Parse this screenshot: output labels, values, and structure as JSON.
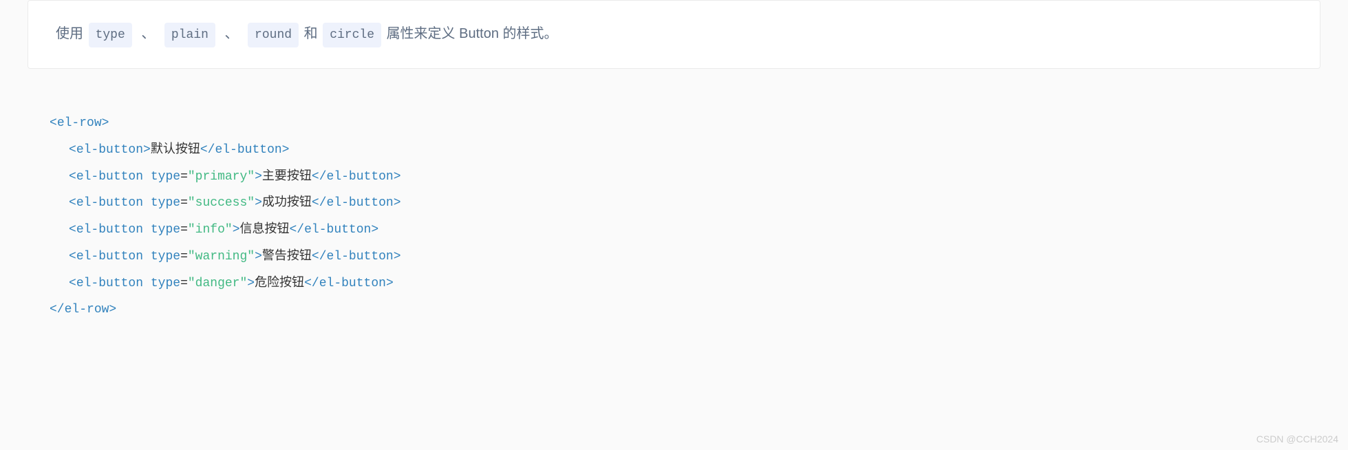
{
  "description": {
    "prefix": "使用",
    "code1": "type",
    "sep": "、",
    "code2": "plain",
    "code3": "round",
    "and": "和",
    "code4": "circle",
    "suffix": "属性来定义 Button 的样式。"
  },
  "code": {
    "rowOpen": {
      "lt": "<",
      "name": "el-row",
      "gt": ">"
    },
    "rowClose": {
      "lt": "</",
      "name": "el-row",
      "gt": ">"
    },
    "btnTag": "el-button",
    "typeAttr": "type",
    "lines": [
      {
        "attr": null,
        "text": "默认按钮"
      },
      {
        "attr": "\"primary\"",
        "text": "主要按钮"
      },
      {
        "attr": "\"success\"",
        "text": "成功按钮"
      },
      {
        "attr": "\"info\"",
        "text": "信息按钮"
      },
      {
        "attr": "\"warning\"",
        "text": "警告按钮"
      },
      {
        "attr": "\"danger\"",
        "text": "危险按钮"
      }
    ]
  },
  "watermark": "CSDN @CCH2024"
}
